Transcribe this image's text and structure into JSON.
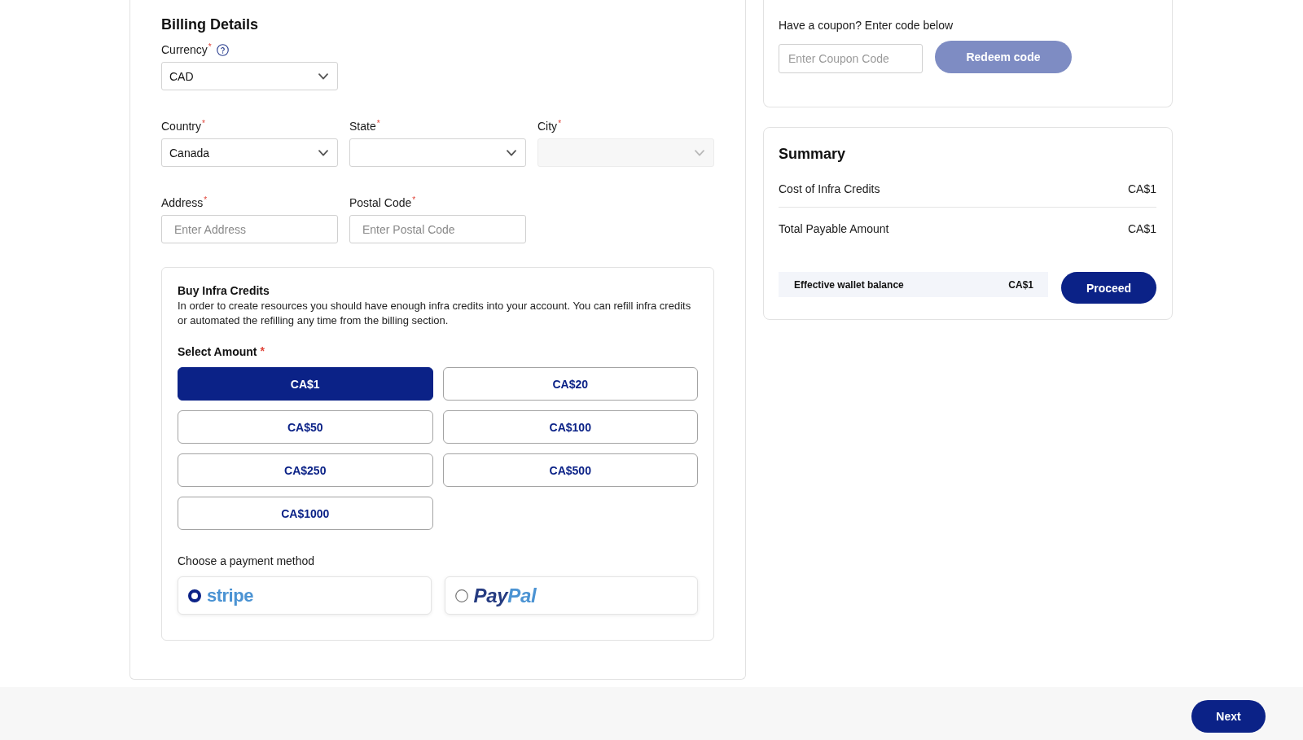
{
  "billing": {
    "title": "Billing Details",
    "rows": [
      {
        "fields": [
          {
            "kind": "select",
            "label": "Currency",
            "asterisk": "*",
            "help": true,
            "value": "CAD",
            "disabled": false
          }
        ]
      },
      {
        "fields": [
          {
            "kind": "select",
            "label": "Country",
            "asterisk": "*",
            "value": "Canada",
            "disabled": false
          },
          {
            "kind": "select",
            "label": "State",
            "asterisk": "*",
            "disabled": false
          },
          {
            "kind": "select",
            "label": "City",
            "asterisk": "*",
            "disabled": true
          }
        ]
      },
      {
        "fields": [
          {
            "kind": "input",
            "label": "Address",
            "asterisk": "*",
            "placeholder": "Enter Address",
            "disabled": false
          },
          {
            "kind": "input",
            "label": "Postal Code",
            "asterisk": "*",
            "placeholder": "Enter Postal Code",
            "disabled": false
          }
        ]
      }
    ],
    "credits": {
      "title": "Buy Infra Credits",
      "description": "In order to create resources you should have enough infra credits into your account. You can refill infra credits or automated the refilling any time from the billing section.",
      "amount_label": "Select Amount",
      "amount_asterisk": "*",
      "amounts": [
        {
          "label": "CA$1",
          "selected": true
        },
        {
          "label": "CA$20",
          "selected": false
        },
        {
          "label": "CA$50",
          "selected": false
        },
        {
          "label": "CA$100",
          "selected": false
        },
        {
          "label": "CA$250",
          "selected": false
        },
        {
          "label": "CA$500",
          "selected": false
        },
        {
          "label": "CA$1000",
          "selected": false
        }
      ],
      "payment_label": "Choose a payment method",
      "payment_methods": [
        {
          "kind": "stripe",
          "selected": true,
          "logo_parts": [
            {
              "text": "stripe",
              "color": "#4b93d3"
            }
          ]
        },
        {
          "kind": "paypal",
          "selected": false,
          "logo_parts": [
            {
              "text": "Pay",
              "color": "#253b80"
            },
            {
              "text": "Pal",
              "color": "#4b93d3"
            }
          ]
        }
      ]
    }
  },
  "coupon": {
    "label": "Have a coupon? Enter code below",
    "placeholder": "Enter Coupon Code",
    "button": {
      "label": "Redeem code",
      "disabled": true
    }
  },
  "summary": {
    "title": "Summary",
    "rows": [
      {
        "label": "Cost of Infra Credits",
        "value": "CA$1"
      },
      {
        "label": "Total Payable Amount",
        "value": "CA$1"
      }
    ],
    "wallet": {
      "label": "Effective wallet balance",
      "value": "CA$1"
    },
    "button": "Proceed"
  },
  "footer": {
    "button": "Next"
  }
}
